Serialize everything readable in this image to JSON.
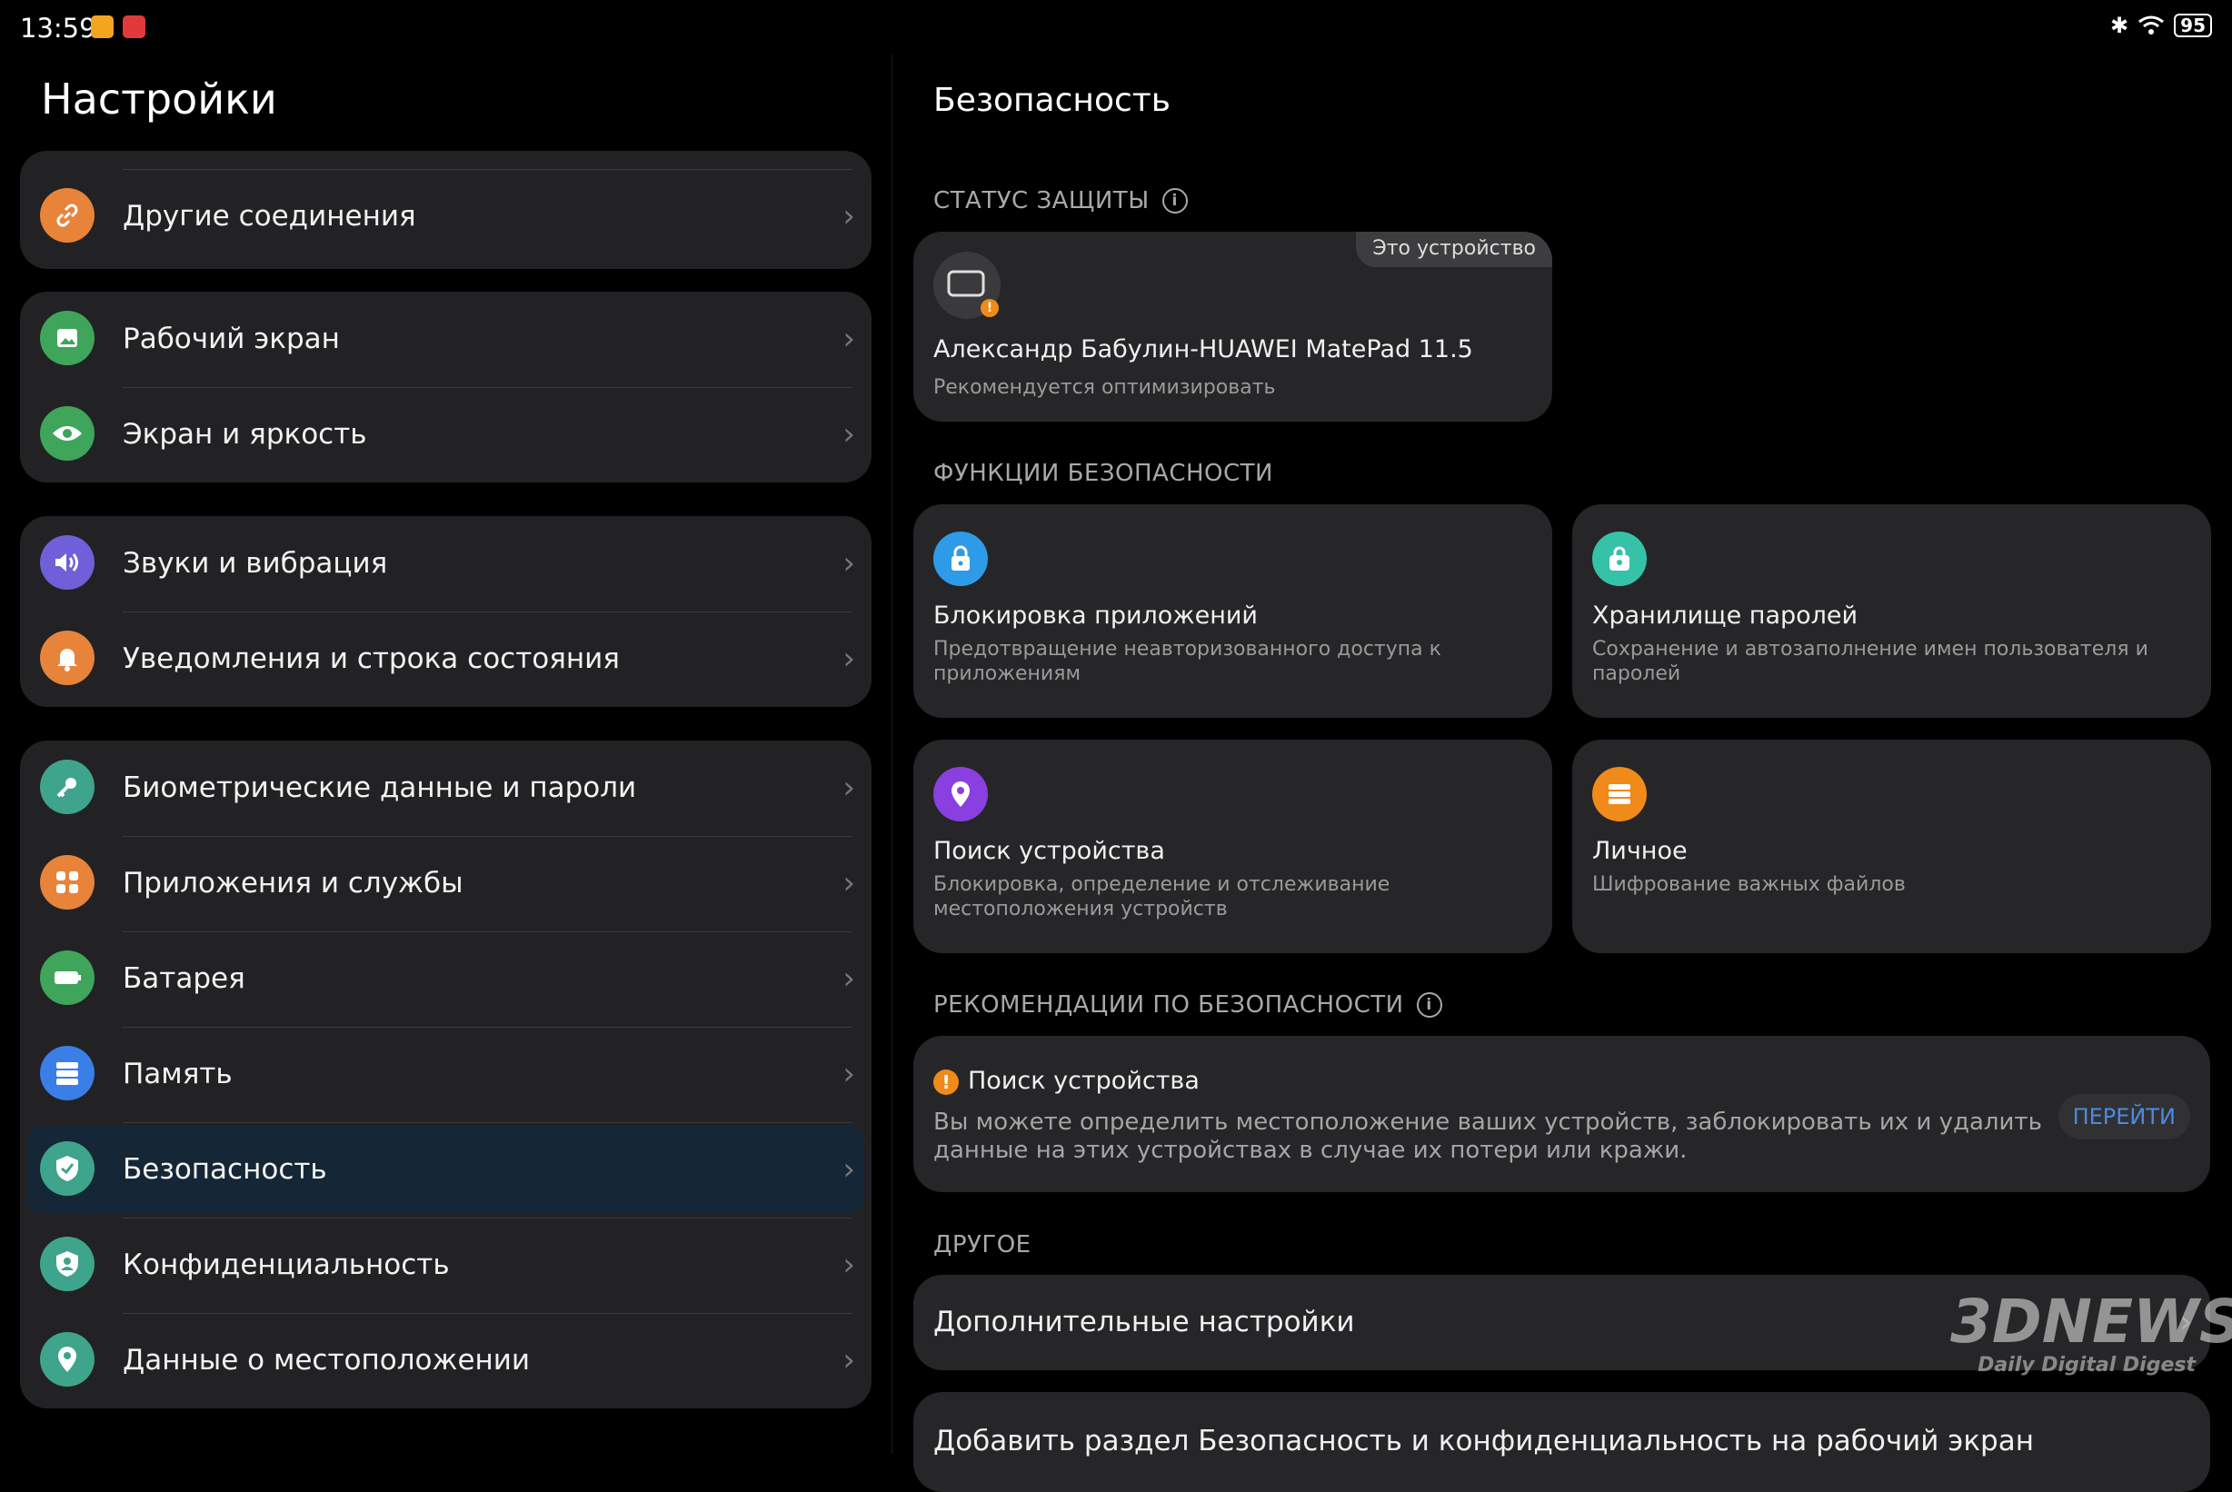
{
  "status_bar": {
    "time": "13:59",
    "battery": "95"
  },
  "left": {
    "title": "Настройки",
    "groups": [
      {
        "items": [
          {
            "label": "Другие соединения",
            "icon": "link-icon",
            "color": "#e8833a"
          }
        ]
      },
      {
        "items": [
          {
            "label": "Рабочий экран",
            "icon": "image-icon",
            "color": "#3ea55a"
          },
          {
            "label": "Экран и яркость",
            "icon": "eye-icon",
            "color": "#3ea55a"
          }
        ]
      },
      {
        "items": [
          {
            "label": "Звуки и вибрация",
            "icon": "speaker-icon",
            "color": "#6f5fd8"
          },
          {
            "label": "Уведомления и строка состояния",
            "icon": "bell-icon",
            "color": "#e8833a"
          }
        ]
      },
      {
        "items": [
          {
            "label": "Биометрические данные и пароли",
            "icon": "key-icon",
            "color": "#3fa48c"
          },
          {
            "label": "Приложения и службы",
            "icon": "apps-icon",
            "color": "#e8833a"
          },
          {
            "label": "Батарея",
            "icon": "battery-icon",
            "color": "#3ea55a"
          },
          {
            "label": "Память",
            "icon": "storage-icon",
            "color": "#3a7ee8"
          },
          {
            "label": "Безопасность",
            "icon": "shield-icon",
            "color": "#3fa48c",
            "selected": true
          },
          {
            "label": "Конфиденциальность",
            "icon": "privacy-icon",
            "color": "#3fa48c"
          },
          {
            "label": "Данные о местоположении",
            "icon": "location-icon",
            "color": "#3fa48c"
          }
        ]
      }
    ]
  },
  "right": {
    "title": "Безопасность",
    "protection_label": "СТАТУС ЗАЩИТЫ",
    "device": {
      "tag": "Это устройство",
      "name": "Александр Бабулин-HUAWEI MatePad 11.5",
      "status": "Рекомендуется оптимизировать"
    },
    "features_label": "ФУНКЦИИ БЕЗОПАСНОСТИ",
    "features": [
      {
        "title": "Блокировка приложений",
        "subtitle": "Предотвращение неавторизованного доступа к приложениям",
        "icon": "lock-icon",
        "color": "#2e9be8"
      },
      {
        "title": "Хранилище паролей",
        "subtitle": "Сохранение и автозаполнение имен пользователя и паролей",
        "icon": "password-vault-icon",
        "color": "#36c2a8"
      },
      {
        "title": "Поиск устройства",
        "subtitle": "Блокировка, определение и отслеживание местоположения устройств",
        "icon": "location-pin-icon",
        "color": "#8a3fe0"
      },
      {
        "title": "Личное",
        "subtitle": "Шифрование важных файлов",
        "icon": "safe-icon",
        "color": "#f08a1a"
      }
    ],
    "recommend_label": "РЕКОМЕНДАЦИИ ПО БЕЗОПАСНОСТИ",
    "recommendation": {
      "title": "Поиск устройства",
      "text": "Вы можете определить местоположение ваших устройств, заблокировать их и удалить данные на этих устройствах в случае их потери или кражи.",
      "button": "ПЕРЕЙТИ"
    },
    "other_label": "ДРУГОЕ",
    "other_items": [
      "Дополнительные настройки",
      "Добавить раздел Безопасность и конфиденциальность на рабочий экран"
    ]
  },
  "watermark": {
    "brand": "3DNEWS",
    "tagline": "Daily Digital Digest"
  }
}
